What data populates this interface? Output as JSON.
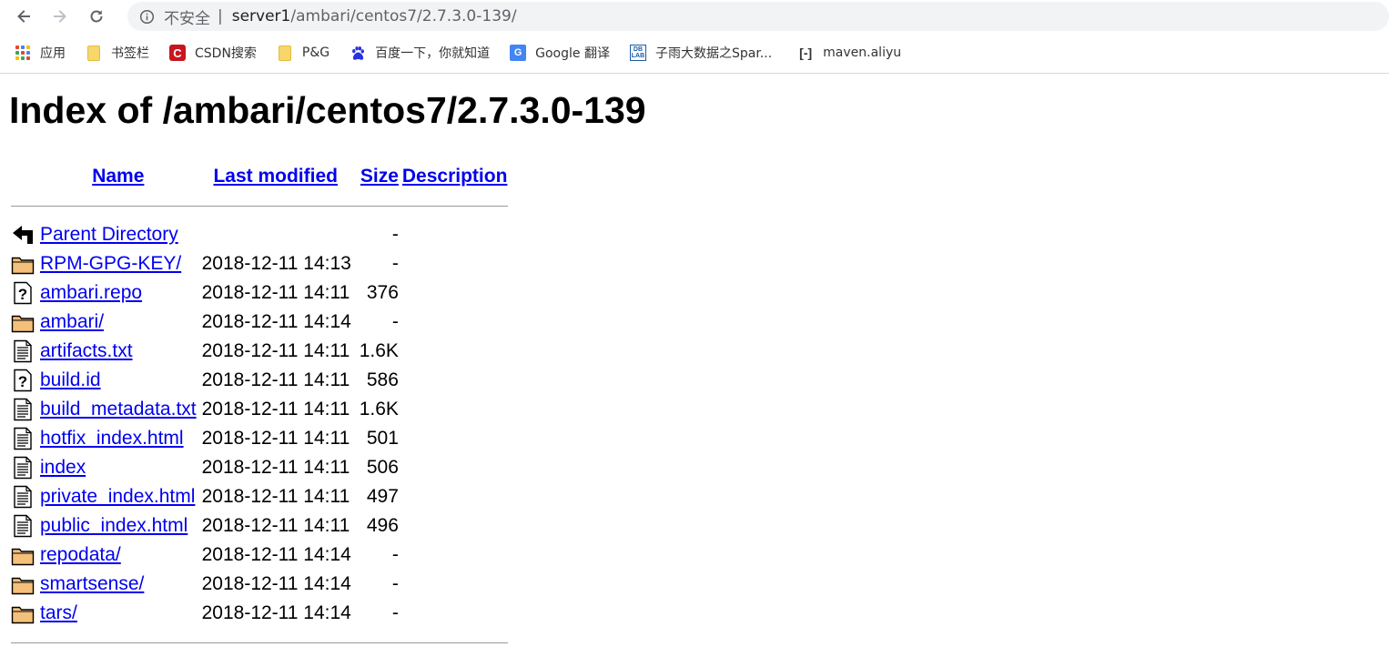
{
  "browser": {
    "address": {
      "security_label": "不安全",
      "divider": "|",
      "host": "server1",
      "path": "/ambari/centos7/2.7.3.0-139/"
    },
    "bookmarks": [
      {
        "label": "应用",
        "icon": "apps-grid-icon"
      },
      {
        "label": "书签栏",
        "icon": "folder-icon"
      },
      {
        "label": "CSDN搜索",
        "icon": "csdn-icon"
      },
      {
        "label": "P&G",
        "icon": "folder-icon"
      },
      {
        "label": "百度一下，你就知道",
        "icon": "baidu-icon"
      },
      {
        "label": "Google 翻译",
        "icon": "google-translate-icon"
      },
      {
        "label": "子雨大数据之Spar...",
        "icon": "dblab-icon"
      },
      {
        "label": "maven.aliyu",
        "icon": "aliyun-icon"
      }
    ],
    "icon_glyphs": {
      "csdn": "C",
      "google_translate": "G",
      "dblab_top": "DB",
      "dblab_bottom": "LAB",
      "aliyun": "[-]"
    }
  },
  "page": {
    "title": "Index of /ambari/centos7/2.7.3.0-139",
    "columns": {
      "name": "Name",
      "last_modified": "Last modified",
      "size": "Size",
      "description": "Description"
    },
    "entries": [
      {
        "icon": "back",
        "name": "Parent Directory",
        "modified": "",
        "size": "-"
      },
      {
        "icon": "folder",
        "name": "RPM-GPG-KEY/",
        "modified": "2018-12-11 14:13",
        "size": "-"
      },
      {
        "icon": "unknown",
        "name": "ambari.repo",
        "modified": "2018-12-11 14:11",
        "size": "376"
      },
      {
        "icon": "folder",
        "name": "ambari/",
        "modified": "2018-12-11 14:14",
        "size": "-"
      },
      {
        "icon": "text",
        "name": "artifacts.txt",
        "modified": "2018-12-11 14:11",
        "size": "1.6K"
      },
      {
        "icon": "unknown",
        "name": "build.id",
        "modified": "2018-12-11 14:11",
        "size": "586"
      },
      {
        "icon": "text",
        "name": "build_metadata.txt",
        "modified": "2018-12-11 14:11",
        "size": "1.6K"
      },
      {
        "icon": "text",
        "name": "hotfix_index.html",
        "modified": "2018-12-11 14:11",
        "size": "501"
      },
      {
        "icon": "text",
        "name": "index",
        "modified": "2018-12-11 14:11",
        "size": "506"
      },
      {
        "icon": "text",
        "name": "private_index.html",
        "modified": "2018-12-11 14:11",
        "size": "497"
      },
      {
        "icon": "text",
        "name": "public_index.html",
        "modified": "2018-12-11 14:11",
        "size": "496"
      },
      {
        "icon": "folder",
        "name": "repodata/",
        "modified": "2018-12-11 14:14",
        "size": "-"
      },
      {
        "icon": "folder",
        "name": "smartsense/",
        "modified": "2018-12-11 14:14",
        "size": "-"
      },
      {
        "icon": "folder",
        "name": "tars/",
        "modified": "2018-12-11 14:14",
        "size": "-"
      }
    ]
  }
}
